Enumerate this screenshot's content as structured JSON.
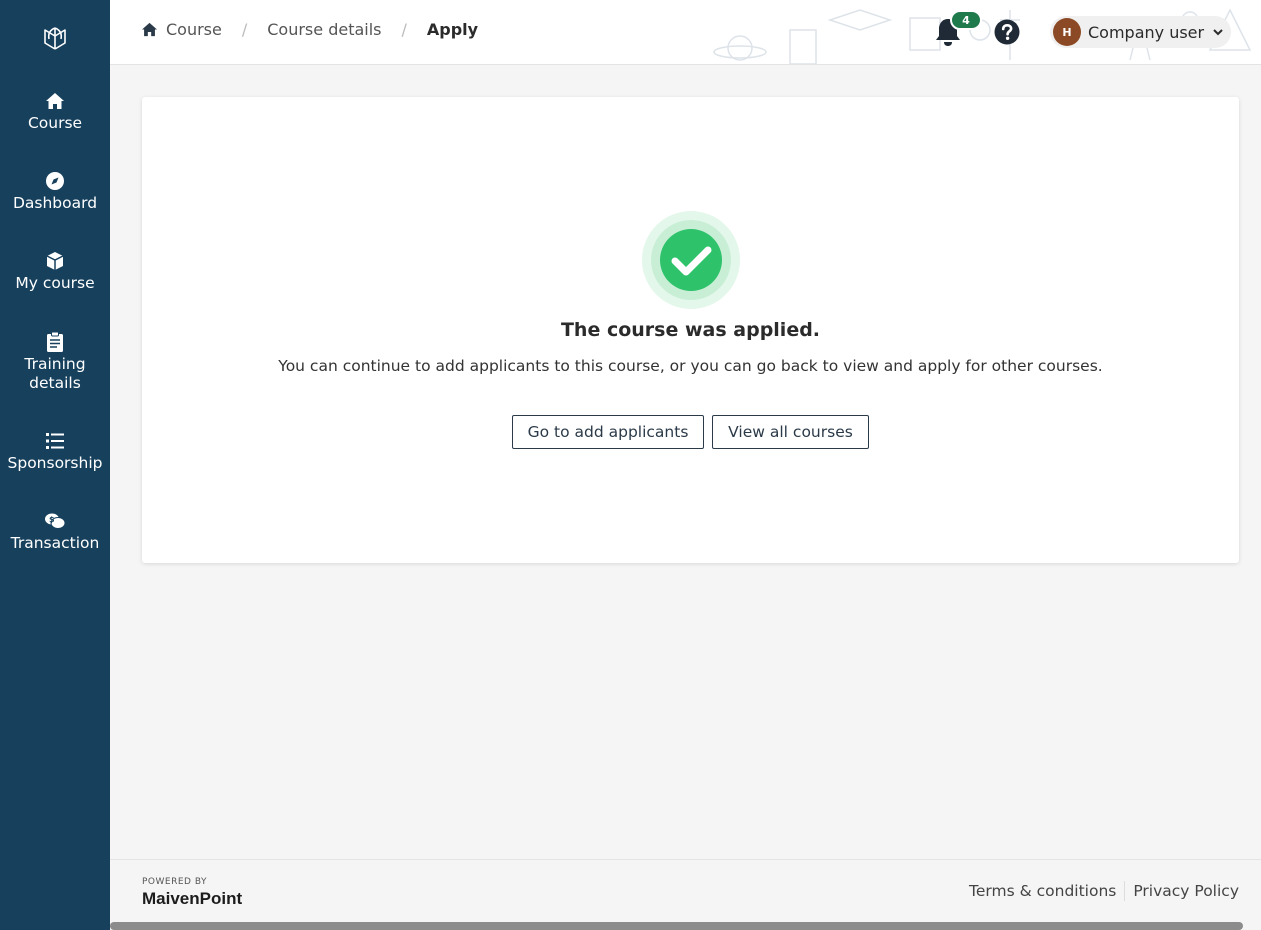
{
  "sidebar": {
    "logo_icon": "leaf-book-icon",
    "items": [
      {
        "label": "Course",
        "icon": "home-icon"
      },
      {
        "label": "Dashboard",
        "icon": "compass-icon"
      },
      {
        "label": "My course",
        "icon": "box-icon"
      },
      {
        "label": "Training details",
        "icon": "clipboard-icon"
      },
      {
        "label": "Sponsorship",
        "icon": "list-icon"
      },
      {
        "label": "Transaction",
        "icon": "chat-dollar-icon"
      }
    ]
  },
  "header": {
    "breadcrumb": [
      {
        "label": "Course",
        "icon": "home-icon"
      },
      {
        "label": "Course details"
      },
      {
        "label": "Apply"
      }
    ],
    "notifications_count": "4",
    "user": {
      "initial": "H",
      "name": "Company user"
    }
  },
  "main": {
    "title": "The course was applied.",
    "description": "You can continue to add applicants to this course, or you can go back to view and apply for other courses.",
    "buttons": {
      "add_applicants": "Go to add applicants",
      "view_all": "View all courses"
    }
  },
  "footer": {
    "powered_by": "POWERED BY",
    "brand": "MaivenPoint",
    "terms": "Terms & conditions",
    "privacy": "Privacy Policy"
  },
  "colors": {
    "sidebar": "#17405d",
    "success": "#2ec26b",
    "badge": "#1f7a4c"
  }
}
